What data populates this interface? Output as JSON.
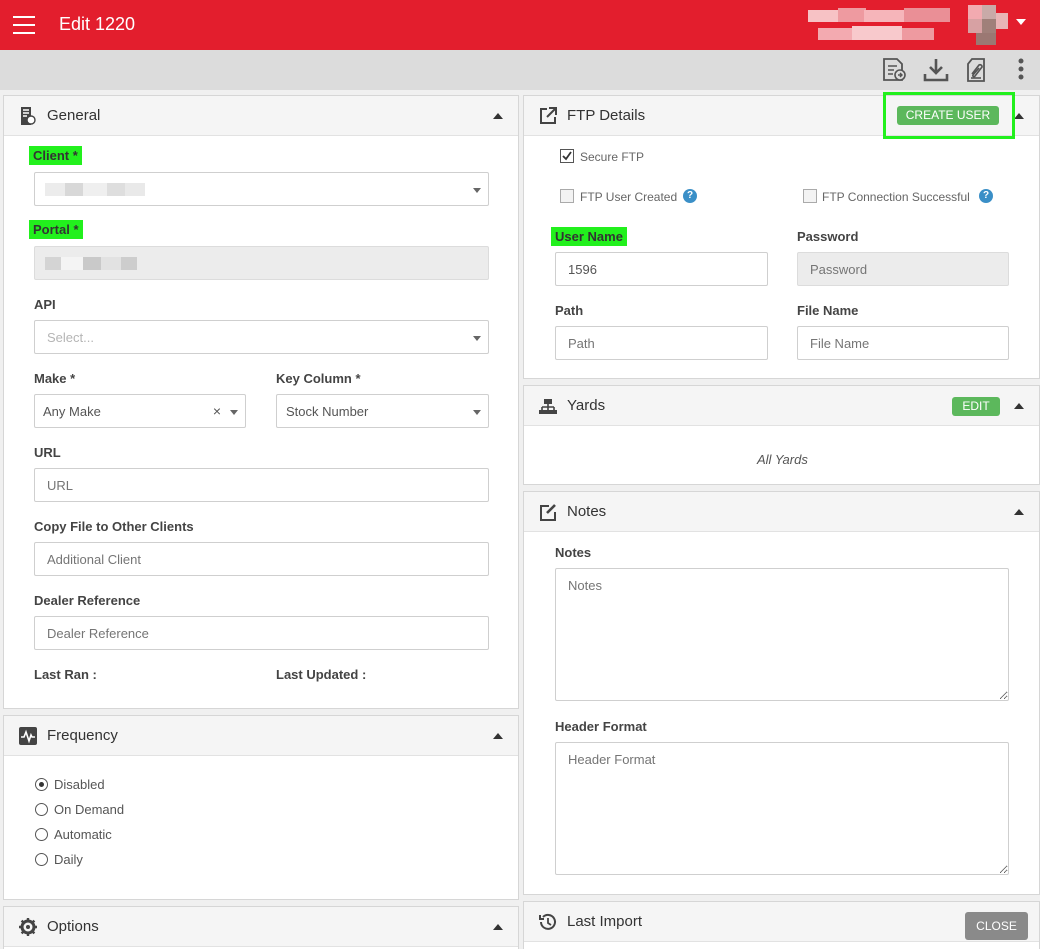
{
  "header": {
    "title": "Edit 1220"
  },
  "general": {
    "title": "General",
    "client_label": "Client *",
    "portal_label": "Portal *",
    "api_label": "API",
    "api_placeholder": "Select...",
    "make_label": "Make *",
    "make_value": "Any Make",
    "make_clear": "×",
    "key_column_label": "Key Column *",
    "key_column_value": "Stock Number",
    "url_label": "URL",
    "url_placeholder": "URL",
    "copy_label": "Copy File to Other Clients",
    "copy_placeholder": "Additional Client",
    "dealer_label": "Dealer Reference",
    "dealer_placeholder": "Dealer Reference",
    "last_ran_label": "Last Ran :",
    "last_updated_label": "Last Updated :"
  },
  "frequency": {
    "title": "Frequency",
    "options": [
      "Disabled",
      "On Demand",
      "Automatic",
      "Daily"
    ],
    "selected": "Disabled"
  },
  "options_panel": {
    "title": "Options"
  },
  "ftp": {
    "title": "FTP Details",
    "create_user_label": "CREATE USER",
    "secure_label": "Secure FTP",
    "secure_checked": true,
    "user_created_label": "FTP User Created",
    "user_created_checked": false,
    "conn_label": "FTP Connection Successful",
    "conn_checked": false,
    "help_glyph": "?",
    "username_label": "User Name",
    "username_value": "1596",
    "password_label": "Password",
    "password_placeholder": "Password",
    "path_label": "Path",
    "path_placeholder": "Path",
    "filename_label": "File Name",
    "filename_placeholder": "File Name"
  },
  "yards": {
    "title": "Yards",
    "edit_label": "EDIT",
    "content": "All Yards"
  },
  "notes": {
    "title": "Notes",
    "notes_label": "Notes",
    "notes_placeholder": "Notes",
    "header_label": "Header Format",
    "header_placeholder": "Header Format"
  },
  "last_import": {
    "title": "Last Import"
  },
  "close_label": "CLOSE",
  "colors": {
    "brand": "#e31e2d",
    "success": "#5cb85c",
    "highlight": "#22f01d"
  },
  "icons": {
    "menu": "hamburger-icon",
    "toolbar": [
      "export-file-icon",
      "download-icon",
      "attachment-icon",
      "more-vertical-icon"
    ],
    "general": "document-icon",
    "frequency": "pulse-icon",
    "options": "gear-icon",
    "ftp": "external-link-icon",
    "yards": "network-icon",
    "notes": "edit-icon",
    "last_import": "history-icon"
  }
}
